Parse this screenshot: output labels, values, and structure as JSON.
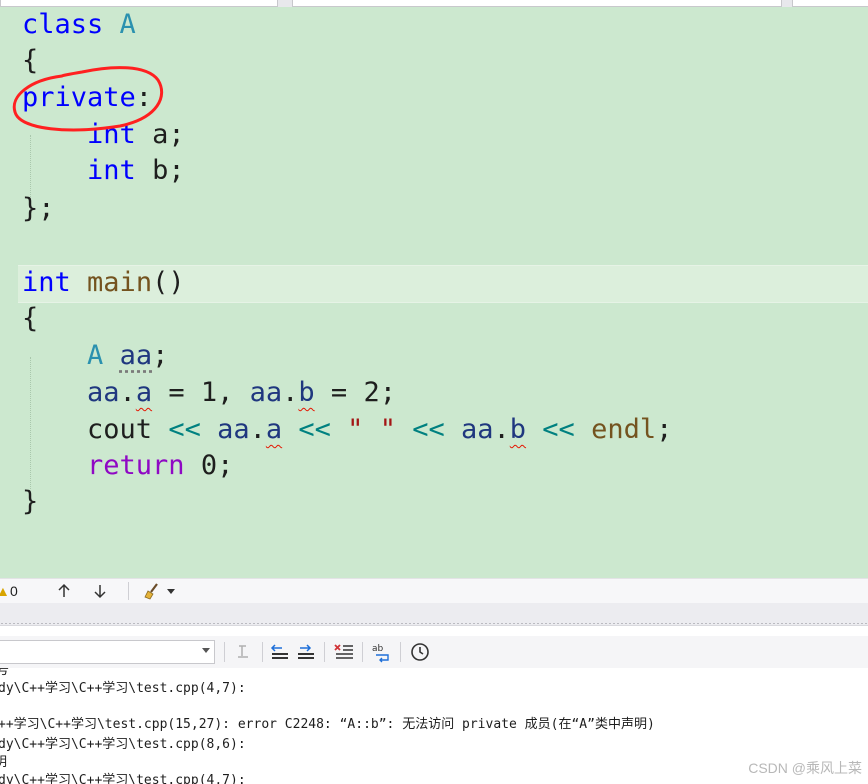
{
  "colors": {
    "editor_bg": "#cce8cf",
    "keyword": "#0000ff",
    "type": "#2b91af",
    "function": "#74531f",
    "variable": "#1f377f",
    "string": "#a31515",
    "operator": "#008080",
    "control_keyword": "#8f08c4",
    "annotation_red": "#ff2020"
  },
  "editor": {
    "lines": {
      "l1_class": "class",
      "l1_name": "A",
      "l2": "{",
      "l3_private": "private",
      "l3_colon": ":",
      "l4_int": "int",
      "l4_rest": " a;",
      "l5_int": "int",
      "l5_rest": " b;",
      "l6": "};",
      "l8_int": "int",
      "l8_main": "main",
      "l8_parens": "()",
      "l9": "{",
      "l10_type": "A",
      "l10_var": "aa",
      "l10_end": ";",
      "l11_aa1": "aa",
      "l11_dot1": ".",
      "l11_a": "a",
      "l11_mid": " = 1, ",
      "l11_aa2": "aa",
      "l11_dot2": ".",
      "l11_b": "b",
      "l11_end": " = 2;",
      "l12_cout": "cout ",
      "l12_op1": "<<",
      "l12_aa1": " aa",
      "l12_dot1": ".",
      "l12_a": "a",
      "l12_op2": " <<",
      "l12_str": " \" \"",
      "l12_op3": " <<",
      "l12_aa2": " aa",
      "l12_dot2": ".",
      "l12_b": "b",
      "l12_op4": " <<",
      "l12_endl": " endl",
      "l12_end": ";",
      "l13_return": "return",
      "l13_rest": " 0;",
      "l14": "}"
    }
  },
  "statusbar": {
    "warning_count": "0",
    "warning_icon": "warning-icon",
    "up_arrow_icon": "arrow-up-icon",
    "down_arrow_icon": "arrow-down-icon",
    "brush_icon": "cleanup-brush-icon"
  },
  "output_toolbar": {
    "source_dropdown_value": "",
    "icons": [
      "find-in-output-icon",
      "prev-message-icon",
      "next-message-icon",
      "clear-all-icon",
      "word-wrap-icon",
      "timestamp-clock-icon"
    ]
  },
  "output": {
    "lines": [
      "号",
      "dy\\C++学习\\C++学习\\test.cpp(4,7):",
      "",
      "++学习\\C++学习\\test.cpp(15,27): error C2248: “A::b”: 无法访问 private 成员(在“A”类中声明)",
      "dy\\C++学习\\C++学习\\test.cpp(8,6):",
      "明",
      "dy\\C++学习\\C++学习\\test.cpp(4,7):"
    ]
  },
  "watermark": "CSDN @乘风上菜"
}
